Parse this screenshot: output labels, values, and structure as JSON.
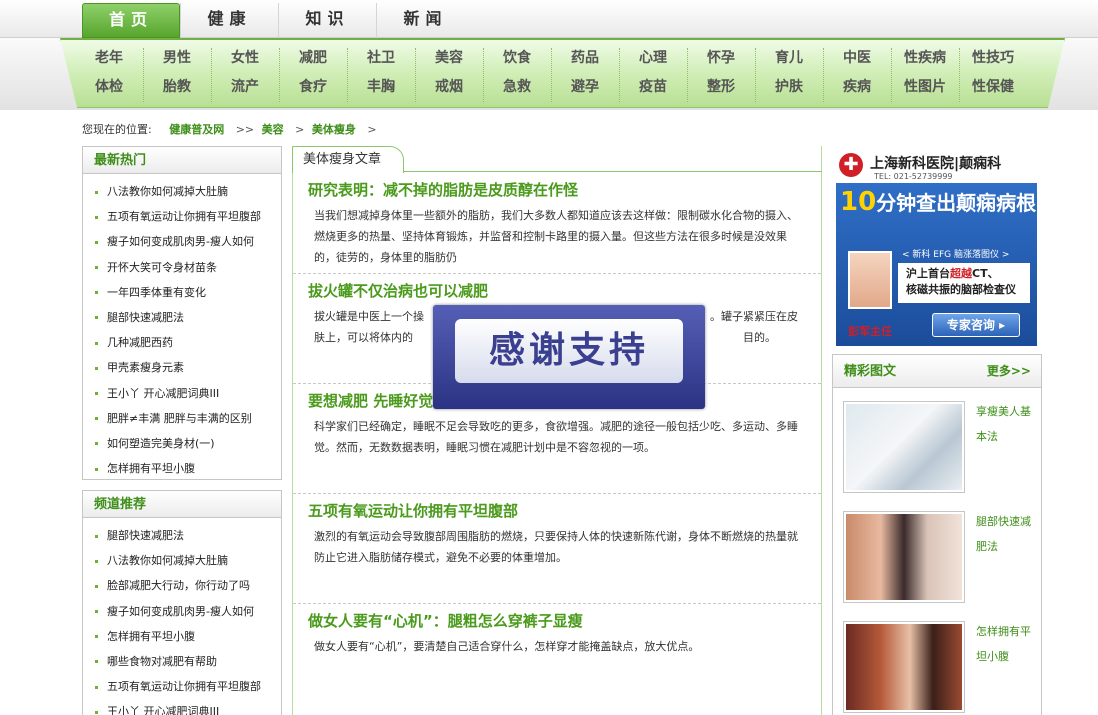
{
  "top_tabs": [
    "首页",
    "健康",
    "知识",
    "新闻"
  ],
  "nav": {
    "row1": [
      "老年",
      "男性",
      "女性",
      "减肥",
      "社卫",
      "美容",
      "饮食",
      "药品",
      "心理",
      "怀孕",
      "育儿",
      "中医",
      "性疾病",
      "性技巧"
    ],
    "row2": [
      "体检",
      "胎教",
      "流产",
      "食疗",
      "丰胸",
      "戒烟",
      "急救",
      "避孕",
      "疫苗",
      "整形",
      "护肤",
      "疾病",
      "性图片",
      "性保健"
    ]
  },
  "breadcrumb": {
    "label": "您现在的位置:",
    "items": [
      "健康普及网",
      "美容",
      "美体瘦身"
    ],
    "sep1": ">>",
    "sep": ">"
  },
  "latest": {
    "title": "最新热门",
    "items": [
      "八法教你如何减掉大肚腩",
      "五项有氧运动让你拥有平坦腹部",
      "瘦子如何变成肌肉男-瘦人如何",
      "开怀大笑可令身材苗条",
      "一年四季体重有变化",
      "腿部快速减肥法",
      "几种减肥西药",
      "甲壳素瘦身元素",
      "王小丫 开心减肥词典III",
      "肥胖≠丰满 肥胖与丰满的区别",
      "如何塑造完美身材(一)",
      "怎样拥有平坦小腹"
    ]
  },
  "recommend": {
    "title": "频道推荐",
    "items": [
      "腿部快速减肥法",
      "八法教你如何减掉大肚腩",
      "脸部减肥大行动，你行动了吗",
      "瘦子如何变成肌肉男-瘦人如何",
      "怎样拥有平坦小腹",
      "哪些食物对减肥有帮助",
      "五项有氧运动让你拥有平坦腹部",
      "王小丫 开心减肥词典III"
    ]
  },
  "articles": {
    "tab": "美体瘦身文章",
    "list": [
      {
        "title": "研究表明：减不掉的脂肪是皮质醇在作怪",
        "desc": "当我们想减掉身体里一些额外的脂肪，我们大多数人都知道应该去这样做：限制碳水化合物的摄入、燃烧更多的热量、坚持体育锻炼，并监督和控制卡路里的摄入量。但这些方法在很多时候是没效果的，徒劳的，身体里的脂肪仍"
      },
      {
        "title": "拔火罐不仅治病也可以减肥",
        "desc": "拔火罐是中医上一个操　　　　　　　　　　　　　　　　　　　　　　　　　　。罐子紧紧压在皮肤上，可以将体内的　　　　　　　　　　　　　　　　　　　　　　　　　　　　　　目的。"
      },
      {
        "title": "要想减肥 先睡好觉",
        "desc": "科学家们已经确定，睡眠不足会导致吃的更多，食欲增强。减肥的途径一般包括少吃、多运动、多睡觉。然而，无数数据表明，睡眠习惯在减肥计划中是不容忽视的一项。"
      },
      {
        "title": "五项有氧运动让你拥有平坦腹部",
        "desc": "激烈的有氧运动会导致腹部周围脂肪的燃烧，只要保持人体的快速新陈代谢，身体不断燃烧的热量就防止它进入脂肪储存模式，避免不必要的体重增加。"
      },
      {
        "title": "做女人要有“心机”：腿粗怎么穿裤子显瘦",
        "desc": "做女人要有“心机”，要清楚自己适合穿什么，怎样穿才能掩盖缺点，放大优点。"
      }
    ]
  },
  "overlay": {
    "text": "感谢支持"
  },
  "ad": {
    "hospital": "上海新科医院|颠痫科",
    "tel": "TEL: 021-52739999",
    "headline_num": "10",
    "headline_text": "分钟查出颠痫病根",
    "device": "< 新科 EFG 脑涨落图仪 >",
    "card_line1_a": "沪上首台",
    "card_line1_b": "超越",
    "card_line1_c": "CT、",
    "card_line2": "核磁共振的脑部检查仪",
    "doctor": "彭军主任",
    "button": "专家咨询 ▸"
  },
  "pics": {
    "title": "精彩图文",
    "more": "更多>>",
    "items": [
      {
        "caption": "享瘦美人基本法"
      },
      {
        "caption": "腿部快速减肥法"
      },
      {
        "caption": "怎样拥有平坦小腹"
      }
    ]
  },
  "colors": {
    "brand_green": "#4a9a1c",
    "accent_blue": "#2b3384",
    "ad_blue": "#1b4c9a",
    "ad_red": "#d01f26"
  }
}
